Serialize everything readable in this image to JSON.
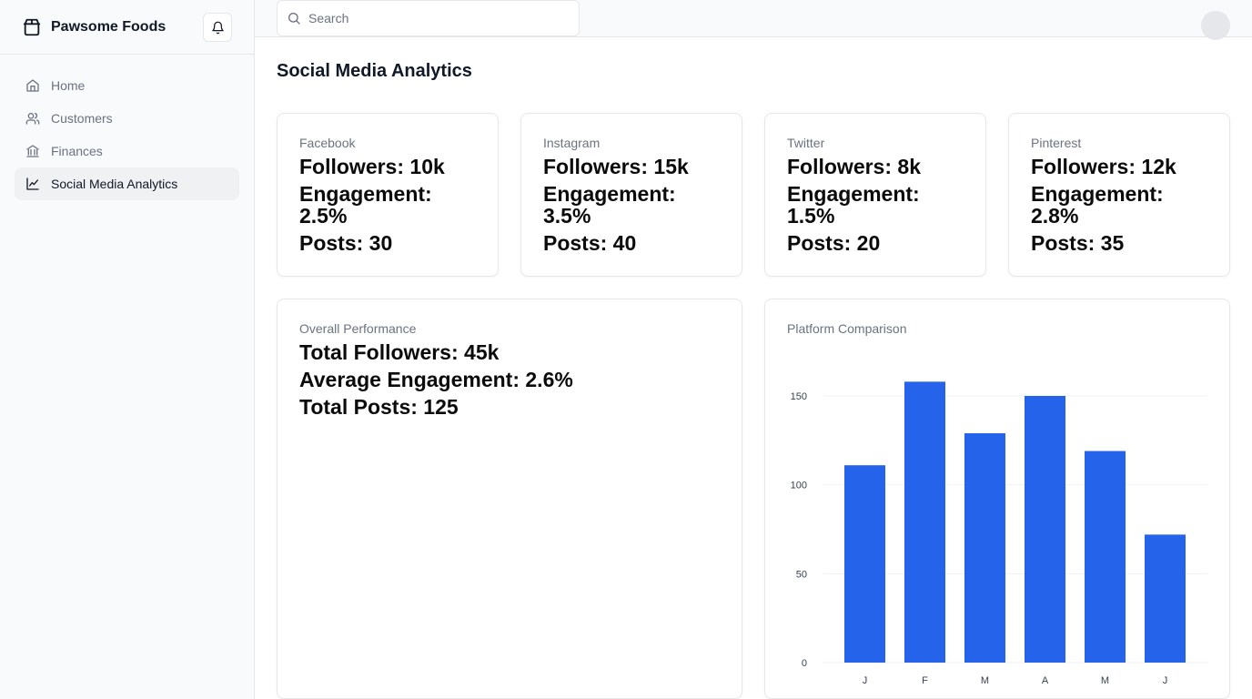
{
  "brand": {
    "name": "Pawsome Foods",
    "icon": "package-icon"
  },
  "sidebar": {
    "items": [
      {
        "label": "Home",
        "icon": "home-icon",
        "active": false
      },
      {
        "label": "Customers",
        "icon": "users-icon",
        "active": false
      },
      {
        "label": "Finances",
        "icon": "bank-icon",
        "active": false
      },
      {
        "label": "Social Media Analytics",
        "icon": "line-chart-icon",
        "active": true
      }
    ]
  },
  "topbar": {
    "search_placeholder": "Search"
  },
  "page": {
    "title": "Social Media Analytics"
  },
  "platforms": [
    {
      "name": "Facebook",
      "followers": "Followers: 10k",
      "engagement": "Engagement: 2.5%",
      "posts": "Posts: 30"
    },
    {
      "name": "Instagram",
      "followers": "Followers: 15k",
      "engagement": "Engagement: 3.5%",
      "posts": "Posts: 40"
    },
    {
      "name": "Twitter",
      "followers": "Followers: 8k",
      "engagement": "Engagement: 1.5%",
      "posts": "Posts: 20"
    },
    {
      "name": "Pinterest",
      "followers": "Followers: 12k",
      "engagement": "Engagement: 2.8%",
      "posts": "Posts: 35"
    }
  ],
  "overall": {
    "title": "Overall Performance",
    "total_followers": "Total Followers: 45k",
    "avg_engagement": "Average Engagement: 2.6%",
    "total_posts": "Total Posts: 125"
  },
  "comparison": {
    "title": "Platform Comparison"
  },
  "chart_data": {
    "type": "bar",
    "categories": [
      "J",
      "F",
      "M",
      "A",
      "M",
      "J"
    ],
    "values": [
      111,
      158,
      129,
      150,
      119,
      72
    ],
    "title": "",
    "xlabel": "",
    "ylabel": "",
    "ylim": [
      0,
      150
    ],
    "yticks": [
      0,
      50,
      100,
      150
    ],
    "grid": true,
    "bar_color": "#2563eb"
  },
  "colors": {
    "accent": "#2563eb",
    "sidebar_bg": "#f9fafb",
    "active_bg": "#f0f1f3"
  }
}
